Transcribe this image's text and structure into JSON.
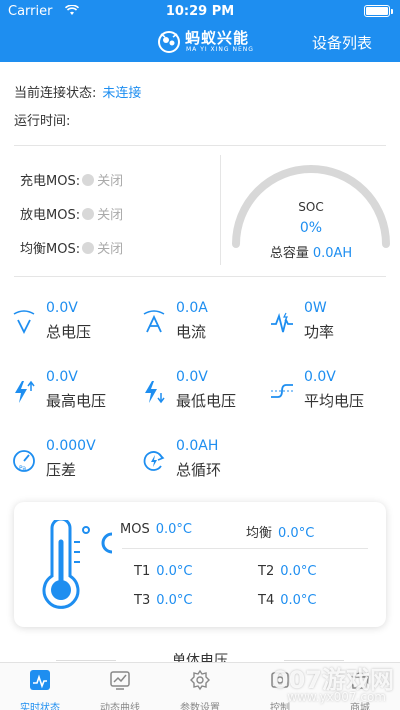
{
  "status_bar": {
    "carrier": "Carrier",
    "time": "10:29 PM"
  },
  "nav": {
    "brand": "蚂蚁兴能",
    "brand_sub": "MA YI XING NENG",
    "devices": "设备列表"
  },
  "connection": {
    "status_label": "当前连接状态:",
    "status_value": "未连接",
    "runtime_label": "运行时间:"
  },
  "mos": {
    "charge": {
      "label": "充电MOS:",
      "state": "关闭"
    },
    "discharge": {
      "label": "放电MOS:",
      "state": "关闭"
    },
    "balance": {
      "label": "均衡MOS:",
      "state": "关闭"
    }
  },
  "soc": {
    "label": "SOC",
    "value": "0%",
    "capacity_label": "总容量",
    "capacity_value": "0.0AH"
  },
  "metrics": [
    {
      "value": "0.0V",
      "label": "总电压",
      "icon": "voltage-v-icon"
    },
    {
      "value": "0.0A",
      "label": "电流",
      "icon": "current-a-icon"
    },
    {
      "value": "0W",
      "label": "功率",
      "icon": "power-wave-icon"
    },
    {
      "value": "0.0V",
      "label": "最高电压",
      "icon": "bolt-up-icon"
    },
    {
      "value": "0.0V",
      "label": "最低电压",
      "icon": "bolt-down-icon"
    },
    {
      "value": "0.0V",
      "label": "平均电压",
      "icon": "average-curve-icon"
    },
    {
      "value": "0.000V",
      "label": "压差",
      "icon": "pressure-gauge-icon"
    },
    {
      "value": "0.0AH",
      "label": "总循环",
      "icon": "cycle-bolt-icon"
    }
  ],
  "temps": {
    "mos_label": "MOS",
    "mos_value": "0.0°C",
    "balance_label": "均衡",
    "balance_value": "0.0°C",
    "t1_label": "T1",
    "t1_value": "0.0°C",
    "t2_label": "T2",
    "t2_value": "0.0°C",
    "t3_label": "T3",
    "t3_value": "0.0°C",
    "t4_label": "T4",
    "t4_value": "0.0°C"
  },
  "cell_title": "单体电压",
  "tabs": [
    {
      "label": "实时状态",
      "icon": "realtime-icon",
      "active": true
    },
    {
      "label": "动态曲线",
      "icon": "chart-icon"
    },
    {
      "label": "参数设置",
      "icon": "settings-icon"
    },
    {
      "label": "控制",
      "icon": "control-icon"
    },
    {
      "label": "商城",
      "icon": "shop-icon"
    }
  ],
  "watermark": {
    "text": "007游戏网",
    "sub": "www.yx007.com"
  },
  "colors": {
    "accent": "#1e8ef0",
    "gauge_track": "#d8d8d8"
  }
}
